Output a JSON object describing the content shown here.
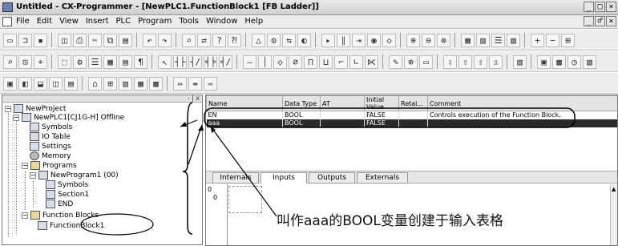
{
  "window": {
    "title": "Untitled - CX-Programmer - [NewPLC1.FunctionBlock1 [FB Ladder]]",
    "controls": [
      "_",
      "□",
      "×"
    ],
    "doc_controls": [
      "_",
      "♂",
      "×"
    ]
  },
  "menu": {
    "items": [
      "File",
      "Edit",
      "View",
      "Insert",
      "PLC",
      "Program",
      "Tools",
      "Window",
      "Help"
    ]
  },
  "toolbar": {
    "row1": [
      "new-file-icon",
      "open-icon",
      "save-icon",
      "print-preview-icon",
      "print-icon",
      "cut-icon",
      "copy-icon",
      "paste-icon",
      "undo-icon",
      "redo-icon",
      "find-icon",
      "replace-icon",
      "help-icon",
      "whats-this-icon"
    ],
    "row2": [
      "zoom-icon",
      "select-icon",
      "grid-icon",
      "contact-icon",
      "coil-icon",
      "instruction-icon",
      "line-icon"
    ],
    "row3": [
      "window-icon",
      "workspace-icon",
      "output-icon",
      "watch-icon",
      "address-icon"
    ]
  },
  "tree": {
    "header_controls": "- | x",
    "items": [
      {
        "label": "NewProject",
        "icon": "project-icon"
      },
      {
        "label": "NewPLC1[CJ1G-H] Offline",
        "icon": "plc-icon"
      },
      {
        "label": "Symbols",
        "icon": "symbols-icon"
      },
      {
        "label": "IO Table",
        "icon": "io-table-icon"
      },
      {
        "label": "Settings",
        "icon": "settings-icon"
      },
      {
        "label": "Memory",
        "icon": "memory-icon"
      },
      {
        "label": "Programs",
        "icon": "programs-icon"
      },
      {
        "label": "NewProgram1 (00)",
        "icon": "program-icon"
      },
      {
        "label": "Symbols",
        "icon": "symbols-icon"
      },
      {
        "label": "Section1",
        "icon": "section-icon"
      },
      {
        "label": "END",
        "icon": "end-icon"
      },
      {
        "label": "Function Blocks",
        "icon": "function-blocks-icon"
      },
      {
        "label": "FunctionBlock1",
        "icon": "function-block-icon"
      }
    ]
  },
  "variables": {
    "columns": [
      "Name",
      "Data Type",
      "AT",
      "Initial Value",
      "Retai...",
      "Comment"
    ],
    "rows": [
      {
        "name": "EN",
        "type": "BOOL",
        "at": "",
        "initial": "FALSE",
        "retain": "",
        "comment": "Controls execution of the Function Block."
      },
      {
        "name": "aaa",
        "type": "BOOL",
        "at": "",
        "initial": "FALSE",
        "retain": "",
        "comment": ""
      }
    ]
  },
  "tabs": [
    "Internals",
    "Inputs",
    "Outputs",
    "Externals"
  ],
  "ladder": {
    "rung_number": "0",
    "rung_address": "0"
  },
  "caption": "叫作aaa的BOOL变量创建于输入表格"
}
